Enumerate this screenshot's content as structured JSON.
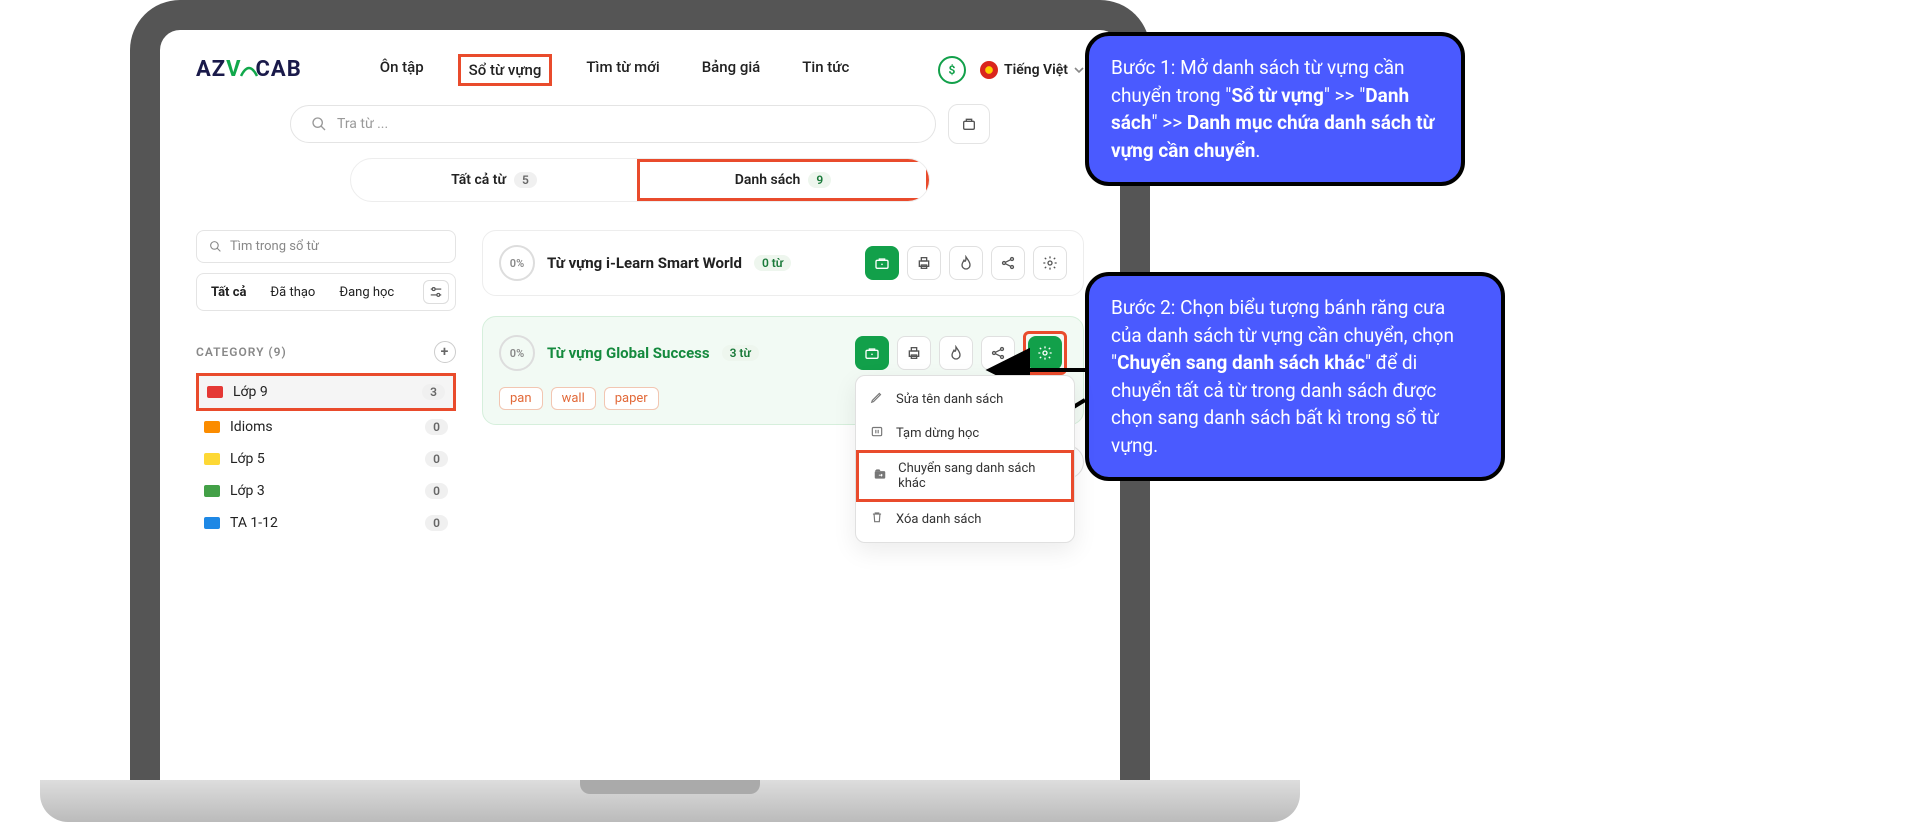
{
  "logo": {
    "text_az": "AZ",
    "text_v": "V",
    "text_ocab": "CAB"
  },
  "nav": {
    "items": [
      "Ôn tập",
      "Sổ từ vựng",
      "Tìm từ mới",
      "Bảng giá",
      "Tin tức"
    ],
    "highlighted_index": 1
  },
  "lang_label": "Tiếng Việt",
  "search": {
    "placeholder": "Tra từ ..."
  },
  "tabs": {
    "all_label": "Tất cả từ",
    "all_count": "5",
    "list_label": "Danh sách",
    "list_count": "9",
    "highlighted": "list"
  },
  "sidebar": {
    "search_placeholder": "Tìm trong sổ từ",
    "filters": [
      "Tất cả",
      "Đã thạo",
      "Đang học"
    ],
    "category_header": "CATEGORY (9)",
    "categories": [
      {
        "name": "Lớp 9",
        "count": "3",
        "color": "red",
        "selected": true
      },
      {
        "name": "Idioms",
        "count": "0",
        "color": "orange"
      },
      {
        "name": "Lớp 5",
        "count": "0",
        "color": "yellow"
      },
      {
        "name": "Lớp 3",
        "count": "0",
        "color": "green"
      },
      {
        "name": "TA 1-12",
        "count": "0",
        "color": "blue"
      }
    ]
  },
  "lists": [
    {
      "pct": "0%",
      "title": "Từ vựng i-Learn Smart World",
      "count": "0 từ",
      "active": false
    },
    {
      "pct": "0%",
      "title": "Từ vựng Global Success",
      "count": "3 từ",
      "active": true,
      "tags": [
        "pan",
        "wall",
        "paper"
      ]
    }
  ],
  "menu": {
    "items": [
      {
        "icon": "pencil",
        "label": "Sửa tên danh sách"
      },
      {
        "icon": "pause",
        "label": "Tạm dừng học"
      },
      {
        "icon": "move",
        "label": "Chuyển sang danh sách khác",
        "highlighted": true
      },
      {
        "icon": "trash",
        "label": "Xóa danh sách"
      }
    ]
  },
  "callouts": {
    "step1_prefix": "Bước 1: Mở danh sách từ vựng cần chuyển trong \"",
    "step1_b1": "Sổ từ vựng",
    "step1_mid1": "\" >> \"",
    "step1_b2": "Danh sách",
    "step1_mid2": "\" >> ",
    "step1_b3": "Danh mục chứa danh sách từ vựng cần chuyển",
    "step1_end": ".",
    "step2_prefix": "Bước 2: Chọn biểu tượng bánh răng cưa của danh sách từ vựng cần chuyển, chọn \"",
    "step2_b1": "Chuyển sang danh sách khác",
    "step2_end": "\" để di chuyển tất cả từ trong danh sách được chọn sang danh sách bất kì trong sổ từ vựng."
  }
}
